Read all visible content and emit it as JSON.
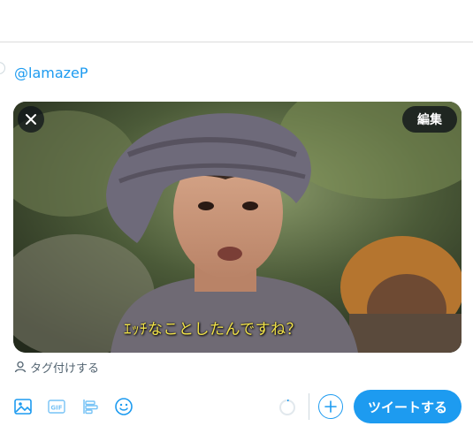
{
  "composer": {
    "reply_to": "@lamazeP",
    "tag_people_label": "タグ付けする",
    "tweet_button_label": "ツイートする"
  },
  "media": {
    "edit_label": "編集",
    "subtitle_text": "ｴｯﾁなことしたんですね？"
  },
  "toolbar": {
    "icons": [
      "image-icon",
      "gif-icon",
      "poll-icon",
      "emoji-icon"
    ]
  },
  "colors": {
    "accent": "#1d9bf0",
    "subtitle": "#f2e34a",
    "muted": "#536471"
  }
}
